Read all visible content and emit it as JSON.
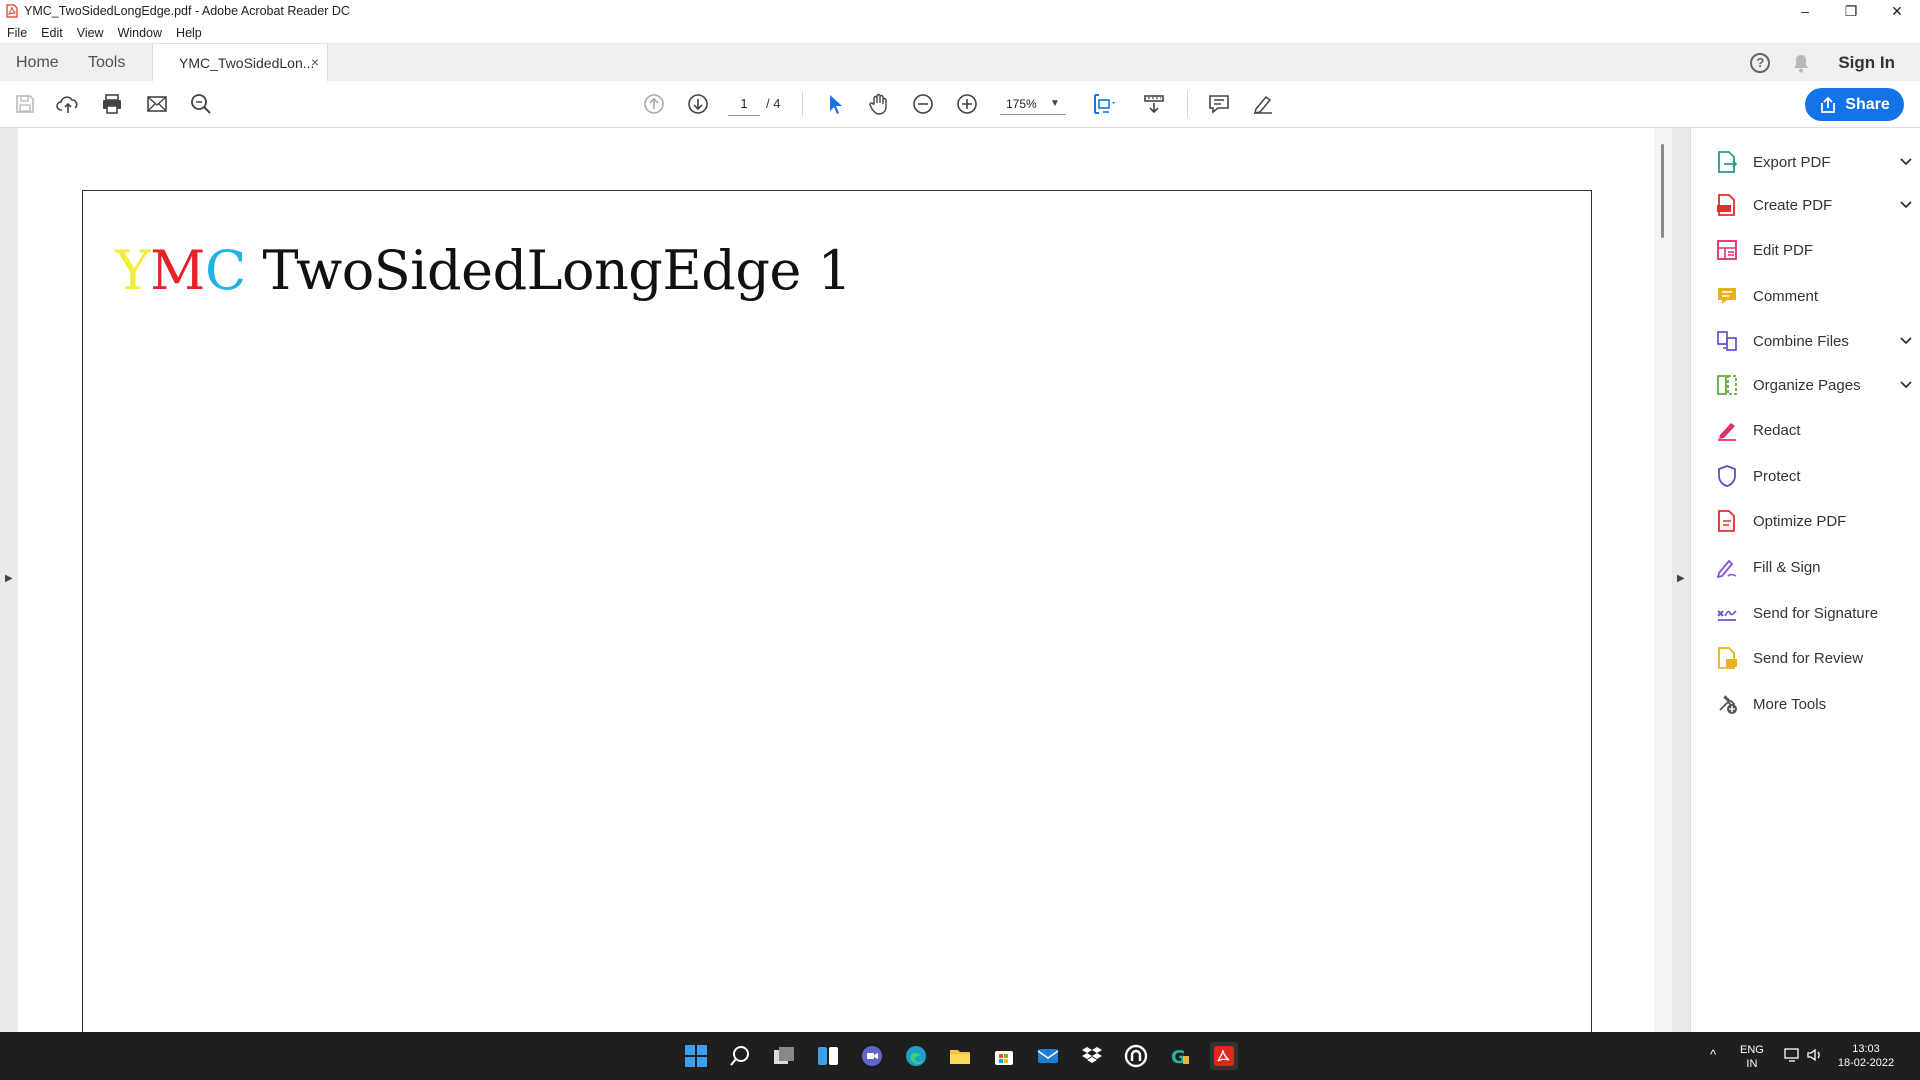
{
  "window": {
    "title": "YMC_TwoSidedLongEdge.pdf - Adobe Acrobat Reader DC",
    "controls": [
      "–",
      "❐",
      "✕"
    ]
  },
  "menu": [
    "File",
    "Edit",
    "View",
    "Window",
    "Help"
  ],
  "tabs": {
    "home": "Home",
    "tools": "Tools",
    "document": "YMC_TwoSidedLon...",
    "close": "×"
  },
  "header": {
    "help": "?",
    "sign_in": "Sign In"
  },
  "toolbar": {
    "current_page": "1",
    "total_pages": "/ 4",
    "zoom": "175%",
    "share_label": "Share"
  },
  "document": {
    "heading_y": "Y",
    "heading_m": "M",
    "heading_c": "C",
    "heading_rest": "TwoSidedLongEdge 1"
  },
  "colors": {
    "yellow": "#f2ef3a",
    "magenta": "#e8202a",
    "cyan": "#20b4e3",
    "accent": "#1473e6"
  },
  "tools_pane": [
    {
      "label": "Export PDF",
      "icon": "export-pdf-icon",
      "expandable": true
    },
    {
      "label": "Create PDF",
      "icon": "create-pdf-icon",
      "expandable": true
    },
    {
      "label": "Edit PDF",
      "icon": "edit-pdf-icon",
      "expandable": false
    },
    {
      "label": "Comment",
      "icon": "comment-icon",
      "expandable": false
    },
    {
      "label": "Combine Files",
      "icon": "combine-files-icon",
      "expandable": true
    },
    {
      "label": "Organize Pages",
      "icon": "organize-pages-icon",
      "expandable": true
    },
    {
      "label": "Redact",
      "icon": "redact-icon",
      "expandable": false
    },
    {
      "label": "Protect",
      "icon": "protect-icon",
      "expandable": false
    },
    {
      "label": "Optimize PDF",
      "icon": "optimize-pdf-icon",
      "expandable": false
    },
    {
      "label": "Fill & Sign",
      "icon": "fill-sign-icon",
      "expandable": false
    },
    {
      "label": "Send for Signature",
      "icon": "send-signature-icon",
      "expandable": false
    },
    {
      "label": "Send for Review",
      "icon": "send-review-icon",
      "expandable": false
    },
    {
      "label": "More Tools",
      "icon": "more-tools-icon",
      "expandable": false
    }
  ],
  "tray": {
    "lang": "ENG",
    "region": "IN",
    "time": "13:03",
    "date": "18-02-2022"
  }
}
